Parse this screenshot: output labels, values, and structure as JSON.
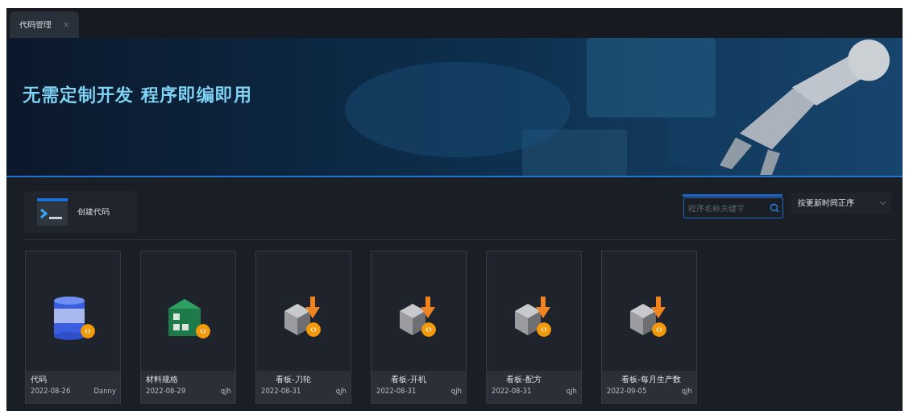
{
  "tabs": [
    {
      "label": "代码管理",
      "selected": true,
      "close": "×"
    }
  ],
  "banner": {
    "headline": "无需定制开发 程序即编即用",
    "kind": "picture"
  },
  "create_button": {
    "label": "创建代码"
  },
  "search": {
    "placeholder": "程序名称关键字"
  },
  "sort": {
    "value": "按更新时间正序"
  },
  "cards": [
    {
      "kind": "database",
      "title": "代码",
      "date": "2022-08-26",
      "author": "Danny"
    },
    {
      "kind": "warehouse",
      "title": "材料规格",
      "date": "2022-08-29",
      "author": "qjh"
    },
    {
      "kind": "cube",
      "title": "看板-刀轮",
      "date": "2022-08-31",
      "author": "qjh"
    },
    {
      "kind": "cube",
      "title": "看板-开机",
      "date": "2022-08-31",
      "author": "qjh"
    },
    {
      "kind": "cube",
      "title": "看板-配方",
      "date": "2022-08-31",
      "author": "qjh"
    },
    {
      "kind": "cube",
      "title": "看板-每月生产数",
      "date": "2022-09-05",
      "author": "qjh"
    }
  ]
}
